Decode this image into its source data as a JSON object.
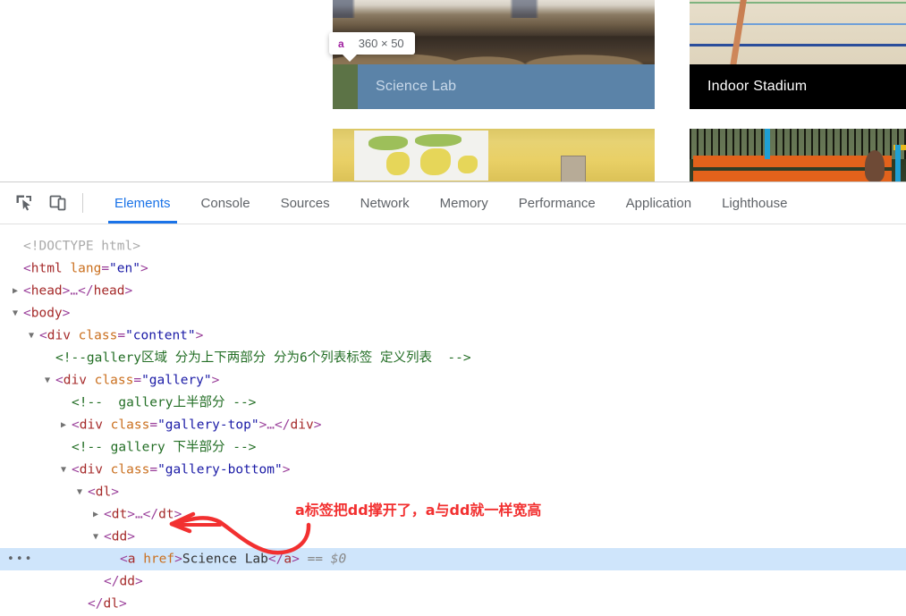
{
  "page": {
    "cards": [
      {
        "title": "Science Lab",
        "image": "science-lab-photo"
      },
      {
        "title": "Indoor Stadium",
        "image": "indoor-stadium-photo"
      },
      {
        "title": "",
        "image": "world-map-classroom-photo"
      },
      {
        "title": "",
        "image": "orange-bench-playground-photo"
      }
    ],
    "highlight_tooltip": {
      "tag": "a",
      "dimensions": "360 × 50"
    },
    "highlight_colors": {
      "content": "#5b83a8",
      "padding": "#5c7346"
    }
  },
  "devtools": {
    "toolbar_icons": [
      {
        "name": "inspect-element-icon",
        "title": "Inspect"
      },
      {
        "name": "device-toolbar-icon",
        "title": "Toggle device toolbar"
      }
    ],
    "tabs": [
      {
        "label": "Elements",
        "active": true
      },
      {
        "label": "Console",
        "active": false
      },
      {
        "label": "Sources",
        "active": false
      },
      {
        "label": "Network",
        "active": false
      },
      {
        "label": "Memory",
        "active": false
      },
      {
        "label": "Performance",
        "active": false
      },
      {
        "label": "Application",
        "active": false
      },
      {
        "label": "Lighthouse",
        "active": false
      }
    ],
    "accent_color": "#1a73e8",
    "selected_row_color": "#cfe5fb",
    "code_lines": [
      {
        "indent": 0,
        "twisty": "none",
        "selected": false,
        "tokens": [
          {
            "t": "doctype",
            "v": "<!DOCTYPE html>"
          }
        ]
      },
      {
        "indent": 0,
        "twisty": "none",
        "selected": false,
        "tokens": [
          {
            "t": "punct",
            "v": "<"
          },
          {
            "t": "tag",
            "v": "html"
          },
          {
            "t": "txt",
            "v": " "
          },
          {
            "t": "attr",
            "v": "lang"
          },
          {
            "t": "punct",
            "v": "="
          },
          {
            "t": "val",
            "v": "\"en\""
          },
          {
            "t": "punct",
            "v": ">"
          }
        ]
      },
      {
        "indent": 0,
        "twisty": "closed",
        "selected": false,
        "tokens": [
          {
            "t": "punct",
            "v": "<"
          },
          {
            "t": "tag",
            "v": "head"
          },
          {
            "t": "punct",
            "v": ">"
          },
          {
            "t": "ell",
            "v": "…"
          },
          {
            "t": "punct",
            "v": "</"
          },
          {
            "t": "tag",
            "v": "head"
          },
          {
            "t": "punct",
            "v": ">"
          }
        ]
      },
      {
        "indent": 0,
        "twisty": "open",
        "selected": false,
        "tokens": [
          {
            "t": "punct",
            "v": "<"
          },
          {
            "t": "tag",
            "v": "body"
          },
          {
            "t": "punct",
            "v": ">"
          }
        ]
      },
      {
        "indent": 1,
        "twisty": "open",
        "selected": false,
        "tokens": [
          {
            "t": "punct",
            "v": "<"
          },
          {
            "t": "tag",
            "v": "div"
          },
          {
            "t": "txt",
            "v": " "
          },
          {
            "t": "attr",
            "v": "class"
          },
          {
            "t": "punct",
            "v": "="
          },
          {
            "t": "val",
            "v": "\"content\""
          },
          {
            "t": "punct",
            "v": ">"
          }
        ]
      },
      {
        "indent": 2,
        "twisty": "none",
        "selected": false,
        "tokens": [
          {
            "t": "cmt",
            "v": "<!--gallery区域 分为上下两部分 分为6个列表标签 定义列表  -->"
          }
        ]
      },
      {
        "indent": 2,
        "twisty": "open",
        "selected": false,
        "tokens": [
          {
            "t": "punct",
            "v": "<"
          },
          {
            "t": "tag",
            "v": "div"
          },
          {
            "t": "txt",
            "v": " "
          },
          {
            "t": "attr",
            "v": "class"
          },
          {
            "t": "punct",
            "v": "="
          },
          {
            "t": "val",
            "v": "\"gallery\""
          },
          {
            "t": "punct",
            "v": ">"
          }
        ]
      },
      {
        "indent": 3,
        "twisty": "none",
        "selected": false,
        "tokens": [
          {
            "t": "cmt",
            "v": "<!--  gallery上半部分 -->"
          }
        ]
      },
      {
        "indent": 3,
        "twisty": "closed",
        "selected": false,
        "tokens": [
          {
            "t": "punct",
            "v": "<"
          },
          {
            "t": "tag",
            "v": "div"
          },
          {
            "t": "txt",
            "v": " "
          },
          {
            "t": "attr",
            "v": "class"
          },
          {
            "t": "punct",
            "v": "="
          },
          {
            "t": "val",
            "v": "\"gallery-top\""
          },
          {
            "t": "punct",
            "v": ">"
          },
          {
            "t": "ell",
            "v": "…"
          },
          {
            "t": "punct",
            "v": "</"
          },
          {
            "t": "tag",
            "v": "div"
          },
          {
            "t": "punct",
            "v": ">"
          }
        ]
      },
      {
        "indent": 3,
        "twisty": "none",
        "selected": false,
        "tokens": [
          {
            "t": "cmt",
            "v": "<!-- gallery 下半部分 -->"
          }
        ]
      },
      {
        "indent": 3,
        "twisty": "open",
        "selected": false,
        "tokens": [
          {
            "t": "punct",
            "v": "<"
          },
          {
            "t": "tag",
            "v": "div"
          },
          {
            "t": "txt",
            "v": " "
          },
          {
            "t": "attr",
            "v": "class"
          },
          {
            "t": "punct",
            "v": "="
          },
          {
            "t": "val",
            "v": "\"gallery-bottom\""
          },
          {
            "t": "punct",
            "v": ">"
          }
        ]
      },
      {
        "indent": 4,
        "twisty": "open",
        "selected": false,
        "tokens": [
          {
            "t": "punct",
            "v": "<"
          },
          {
            "t": "tag",
            "v": "dl"
          },
          {
            "t": "punct",
            "v": ">"
          }
        ]
      },
      {
        "indent": 5,
        "twisty": "closed",
        "selected": false,
        "tokens": [
          {
            "t": "punct",
            "v": "<"
          },
          {
            "t": "tag",
            "v": "dt"
          },
          {
            "t": "punct",
            "v": ">"
          },
          {
            "t": "ell",
            "v": "…"
          },
          {
            "t": "punct",
            "v": "</"
          },
          {
            "t": "tag",
            "v": "dt"
          },
          {
            "t": "punct",
            "v": ">"
          }
        ]
      },
      {
        "indent": 5,
        "twisty": "open",
        "selected": false,
        "tokens": [
          {
            "t": "punct",
            "v": "<"
          },
          {
            "t": "tag",
            "v": "dd"
          },
          {
            "t": "punct",
            "v": ">"
          }
        ]
      },
      {
        "indent": 6,
        "twisty": "none",
        "selected": true,
        "dots": "•••",
        "tokens": [
          {
            "t": "punct",
            "v": "<"
          },
          {
            "t": "tag",
            "v": "a"
          },
          {
            "t": "txt",
            "v": " "
          },
          {
            "t": "attr",
            "v": "href"
          },
          {
            "t": "punct",
            "v": ">"
          },
          {
            "t": "txt",
            "v": "Science Lab"
          },
          {
            "t": "punct",
            "v": "</"
          },
          {
            "t": "tag",
            "v": "a"
          },
          {
            "t": "punct",
            "v": ">"
          },
          {
            "t": "txt",
            "v": " "
          },
          {
            "t": "eq",
            "v": "== $0"
          }
        ]
      },
      {
        "indent": 5,
        "twisty": "none",
        "selected": false,
        "tokens": [
          {
            "t": "punct",
            "v": "</"
          },
          {
            "t": "tag",
            "v": "dd"
          },
          {
            "t": "punct",
            "v": ">"
          }
        ]
      },
      {
        "indent": 4,
        "twisty": "none",
        "selected": false,
        "tokens": [
          {
            "t": "punct",
            "v": "</"
          },
          {
            "t": "tag",
            "v": "dl"
          },
          {
            "t": "punct",
            "v": ">"
          }
        ]
      }
    ]
  },
  "annotation": {
    "text": "a标签把dd撑开了，a与dd就一样宽高",
    "color": "#f23030"
  }
}
